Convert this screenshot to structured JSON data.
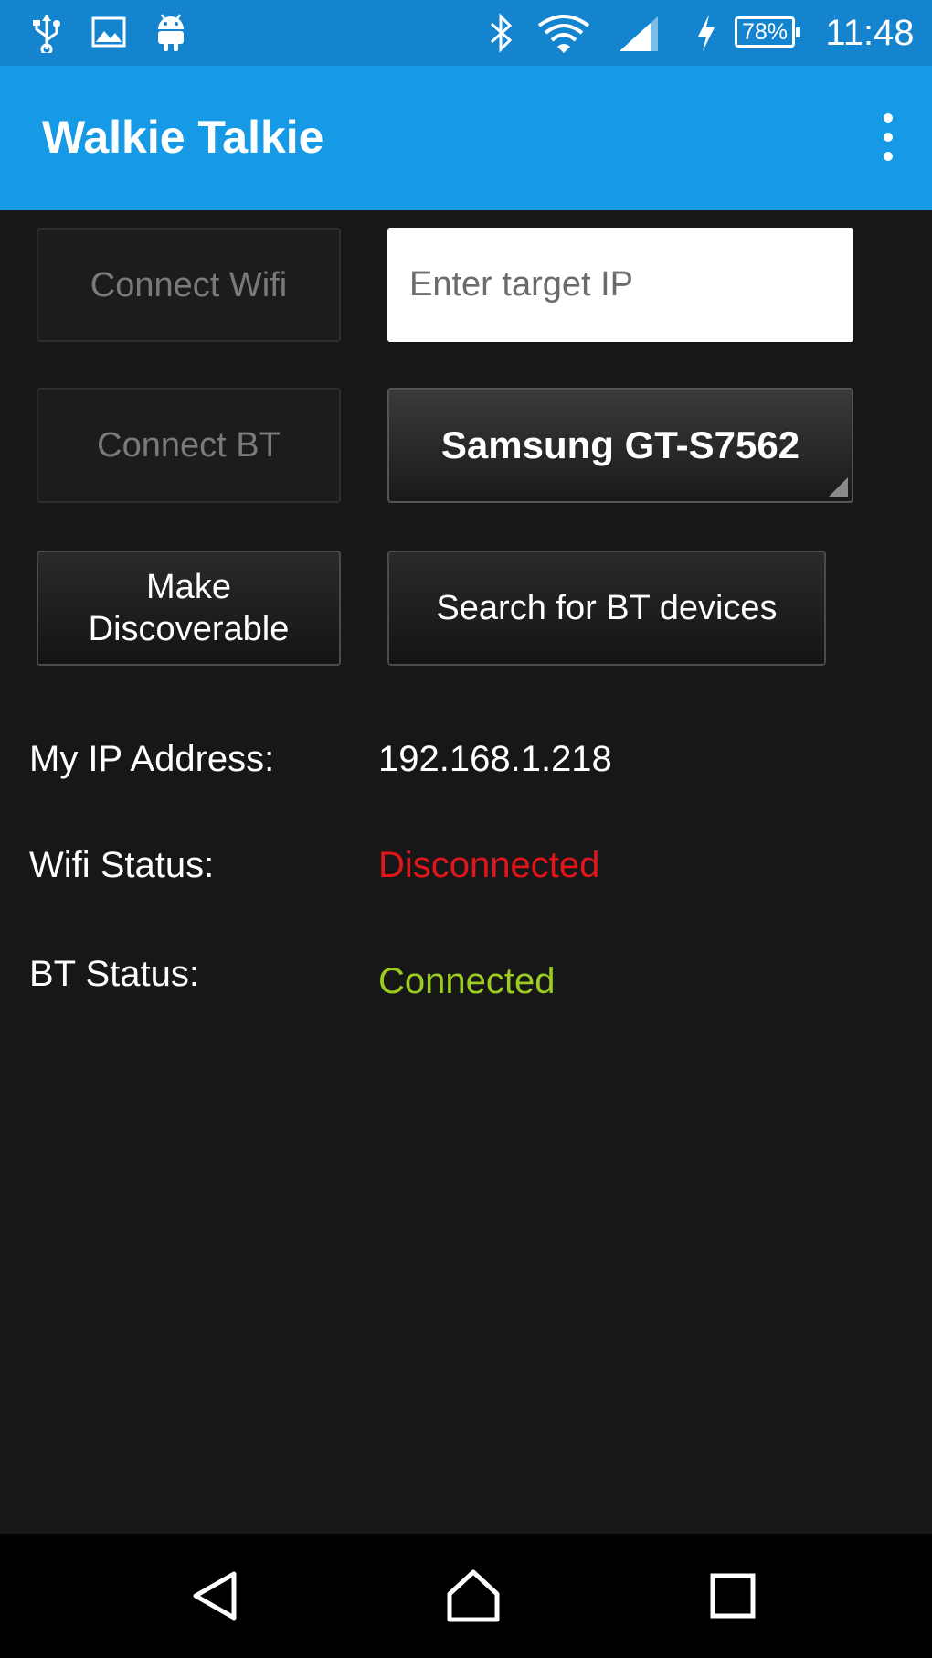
{
  "status_bar": {
    "icons_left": [
      "usb-icon",
      "image-icon",
      "android-icon"
    ],
    "icons_right": [
      "bluetooth-icon",
      "wifi-icon",
      "signal-icon",
      "charging-icon"
    ],
    "battery": {
      "level": 0.78,
      "text": "78%"
    },
    "time": "11:48"
  },
  "app_bar": {
    "title": "Walkie Talkie",
    "menu_icon": "overflow-menu-icon"
  },
  "controls": {
    "connect_wifi": "Connect Wifi",
    "target_ip_placeholder": "Enter target IP",
    "connect_bt": "Connect BT",
    "bt_device_selected": "Samsung GT-S7562",
    "make_discoverable": "Make Discoverable",
    "search_bt": "Search for BT devices"
  },
  "info": {
    "ip_label": "My IP Address:",
    "ip_value": "192.168.1.218",
    "wifi_label": "Wifi Status:",
    "wifi_value": "Disconnected",
    "bt_label": "BT Status:",
    "bt_value": "Connected"
  },
  "colors": {
    "status_bar": "#1584cf",
    "app_bar": "#169ae6",
    "background": "#171717",
    "disconnected": "#e0161b",
    "connected": "#9ccc1f"
  },
  "nav_bar": {
    "icons": [
      "back-icon",
      "home-icon",
      "recents-icon"
    ]
  }
}
